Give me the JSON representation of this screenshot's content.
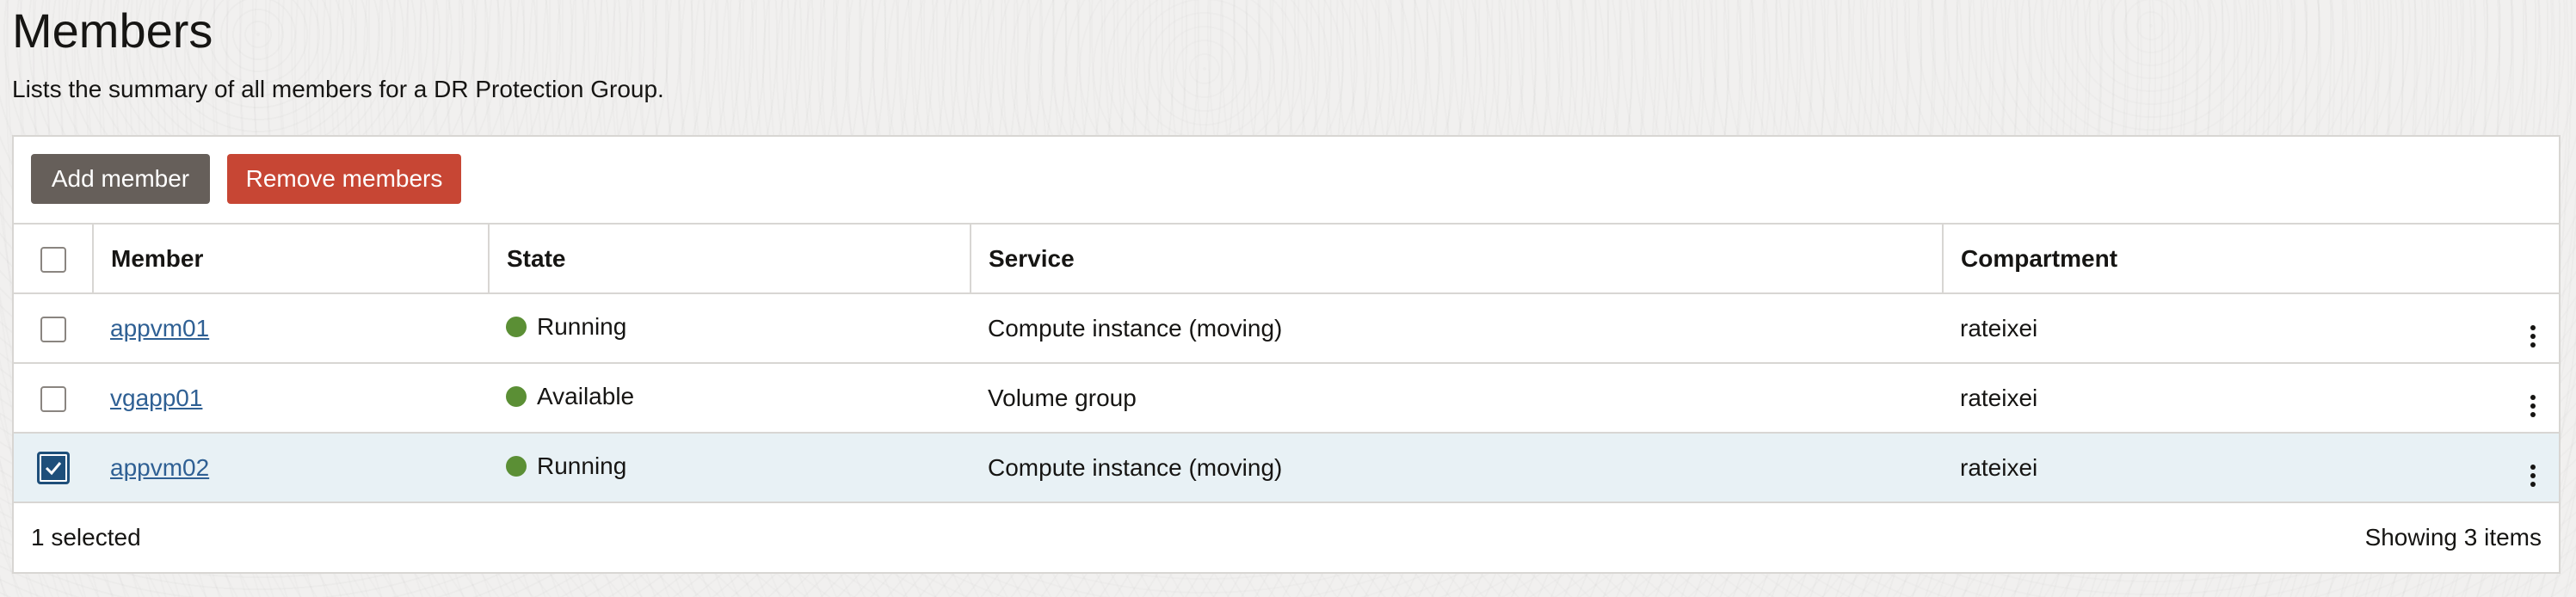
{
  "page": {
    "title": "Members",
    "description": "Lists the summary of all members for a DR Protection Group."
  },
  "toolbar": {
    "add_label": "Add member",
    "remove_label": "Remove members"
  },
  "table": {
    "columns": [
      "Member",
      "State",
      "Service",
      "Compartment"
    ],
    "rows": [
      {
        "member": "appvm01",
        "state": "Running",
        "service": "Compute instance (moving)",
        "compartment": "rateixei",
        "selected": false
      },
      {
        "member": "vgapp01",
        "state": "Available",
        "service": "Volume group",
        "compartment": "rateixei",
        "selected": false
      },
      {
        "member": "appvm02",
        "state": "Running",
        "service": "Compute instance (moving)",
        "compartment": "rateixei",
        "selected": true
      }
    ]
  },
  "footer": {
    "selected_text": "1 selected",
    "count_text": "Showing 3 items"
  },
  "colors": {
    "accent": "#1e4f7a",
    "danger": "#c74634",
    "status_ok": "#5b8f35",
    "link": "#2f6094"
  },
  "icons": {
    "row_actions": "kebab-menu-icon",
    "status": "status-dot-icon",
    "checkmark": "check-icon"
  }
}
